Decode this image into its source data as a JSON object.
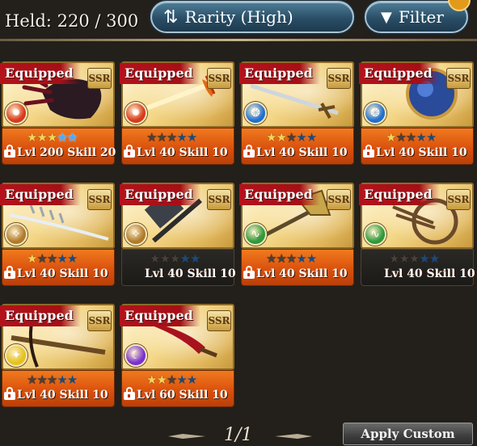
{
  "header": {
    "held_label": "Held:",
    "held_count": "220 / 300",
    "sort_label": "Rarity (High)",
    "filter_label": "Filter"
  },
  "cards": [
    {
      "equipped_label": "Equipped",
      "rarity": "SSR",
      "element": "fire",
      "element_color": "#d83a1a",
      "weapon_icon": "claw-gauntlet-icon",
      "uncaps": 3,
      "transcends": 2,
      "level_text": "Lvl 200 Skill 20",
      "locked": true,
      "footer": "orange"
    },
    {
      "equipped_label": "Equipped",
      "rarity": "SSR",
      "element": "fire",
      "element_color": "#d83a1a",
      "weapon_icon": "flame-sword-icon",
      "uncaps": 0,
      "transcends": 0,
      "level_text": "Lvl 40 Skill 10",
      "locked": true,
      "footer": "orange"
    },
    {
      "equipped_label": "Equipped",
      "rarity": "SSR",
      "element": "water",
      "element_color": "#1f6fd0",
      "weapon_icon": "long-sword-icon",
      "uncaps": 2,
      "transcends": 0,
      "level_text": "Lvl 40 Skill 10",
      "locked": true,
      "footer": "orange"
    },
    {
      "equipped_label": "Equipped",
      "rarity": "SSR",
      "element": "water",
      "element_color": "#1f6fd0",
      "weapon_icon": "orb-icon",
      "uncaps": 1,
      "transcends": 0,
      "level_text": "Lvl 40 Skill 10",
      "locked": true,
      "footer": "orange"
    },
    {
      "equipped_label": "Equipped",
      "rarity": "SSR",
      "element": "earth",
      "element_color": "#b07a2a",
      "weapon_icon": "bone-spear-icon",
      "uncaps": 1,
      "transcends": 0,
      "level_text": "Lvl 40 Skill 10",
      "locked": true,
      "footer": "orange"
    },
    {
      "equipped_label": "Equipped",
      "rarity": "SSR",
      "element": "earth",
      "element_color": "#b07a2a",
      "weapon_icon": "hammer-icon",
      "uncaps": 0,
      "transcends": 0,
      "level_text": "Lvl 40 Skill 10",
      "locked": false,
      "footer": "dark"
    },
    {
      "equipped_label": "Equipped",
      "rarity": "SSR",
      "element": "wind",
      "element_color": "#2e9a3a",
      "weapon_icon": "axe-icon",
      "uncaps": 0,
      "transcends": 0,
      "level_text": "Lvl 40 Skill 10",
      "locked": true,
      "footer": "orange"
    },
    {
      "equipped_label": "Equipped",
      "rarity": "SSR",
      "element": "wind",
      "element_color": "#2e9a3a",
      "weapon_icon": "harp-icon",
      "uncaps": 0,
      "transcends": 0,
      "level_text": "Lvl 40 Skill 10",
      "locked": false,
      "footer": "dark"
    },
    {
      "equipped_label": "Equipped",
      "rarity": "SSR",
      "element": "light",
      "element_color": "#e7c21a",
      "weapon_icon": "crossbow-icon",
      "uncaps": 0,
      "transcends": 0,
      "level_text": "Lvl 40 Skill 10",
      "locked": true,
      "footer": "orange"
    },
    {
      "equipped_label": "Equipped",
      "rarity": "SSR",
      "element": "dark",
      "element_color": "#7a2fd0",
      "weapon_icon": "crimson-blade-icon",
      "uncaps": 2,
      "transcends": 0,
      "level_text": "Lvl 60 Skill 10",
      "locked": true,
      "footer": "orange"
    }
  ],
  "pagination": {
    "page": "1/1"
  },
  "apply_filter_label": "Apply Custom Filter"
}
